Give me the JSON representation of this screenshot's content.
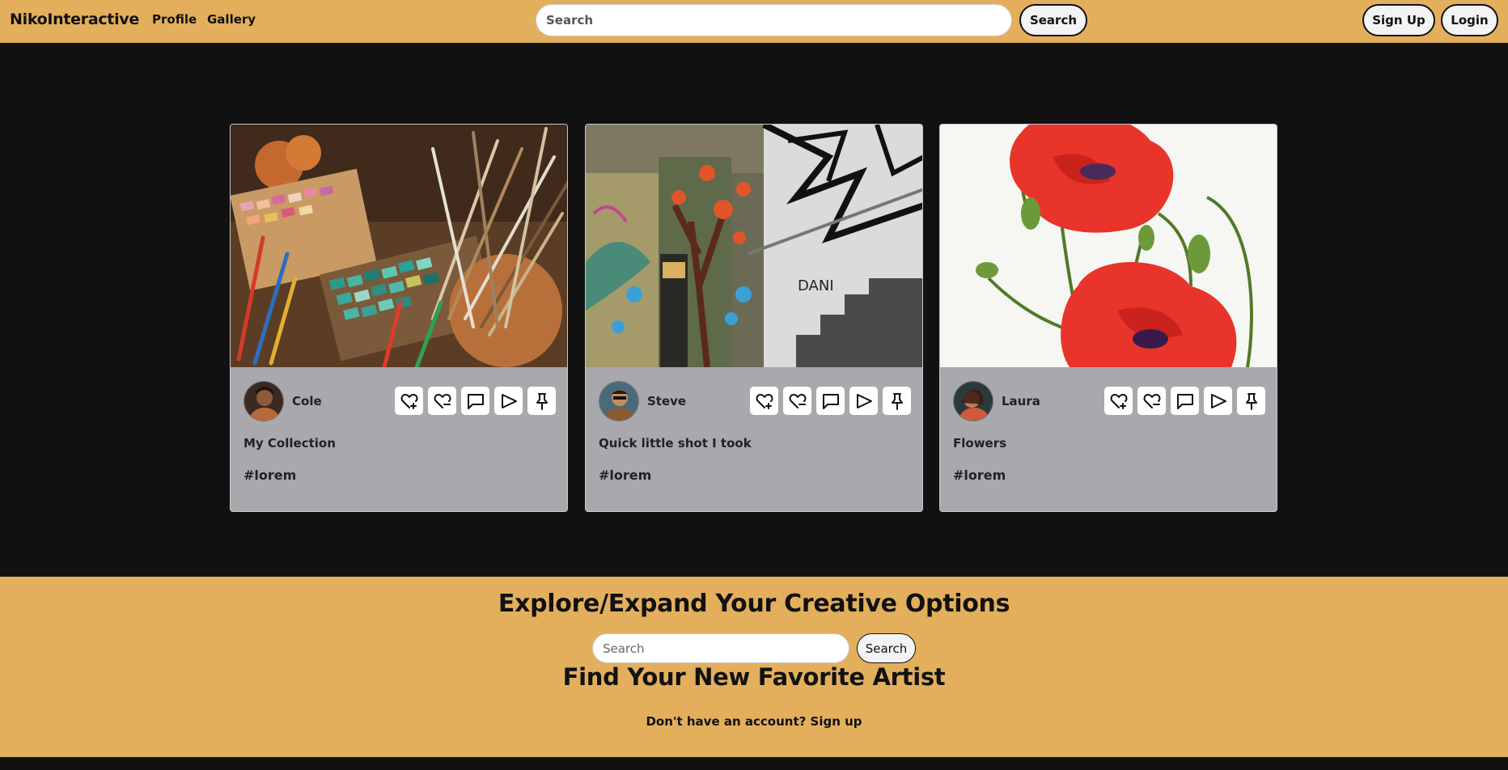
{
  "nav": {
    "brand": "NikoInteractive",
    "links": [
      "Profile",
      "Gallery"
    ],
    "search_placeholder": "Search",
    "search_button": "Search",
    "signup_button": "Sign Up",
    "login_button": "Login"
  },
  "cards": [
    {
      "author": "Cole",
      "title": "My Collection",
      "tag": "#lorem",
      "image": "art-supplies-photo"
    },
    {
      "author": "Steve",
      "title": "Quick little shot I took",
      "tag": "#lorem",
      "image": "graffiti-stairwell-photo"
    },
    {
      "author": "Laura",
      "title": "Flowers",
      "tag": "#lorem",
      "image": "poppy-flowers-drawing"
    }
  ],
  "card_actions": [
    "heart-plus-icon",
    "heart-minus-icon",
    "comment-icon",
    "send-icon",
    "pin-icon"
  ],
  "explore": {
    "heading": "Explore/Expand Your Creative Options",
    "search_placeholder": "Search",
    "search_button": "Search",
    "subheading": "Find Your New Favorite Artist",
    "signup_prompt": "Don't have an account? Sign up"
  },
  "colors": {
    "accent": "#e3af5d",
    "background": "#111111",
    "card": "#a9a8ad"
  }
}
